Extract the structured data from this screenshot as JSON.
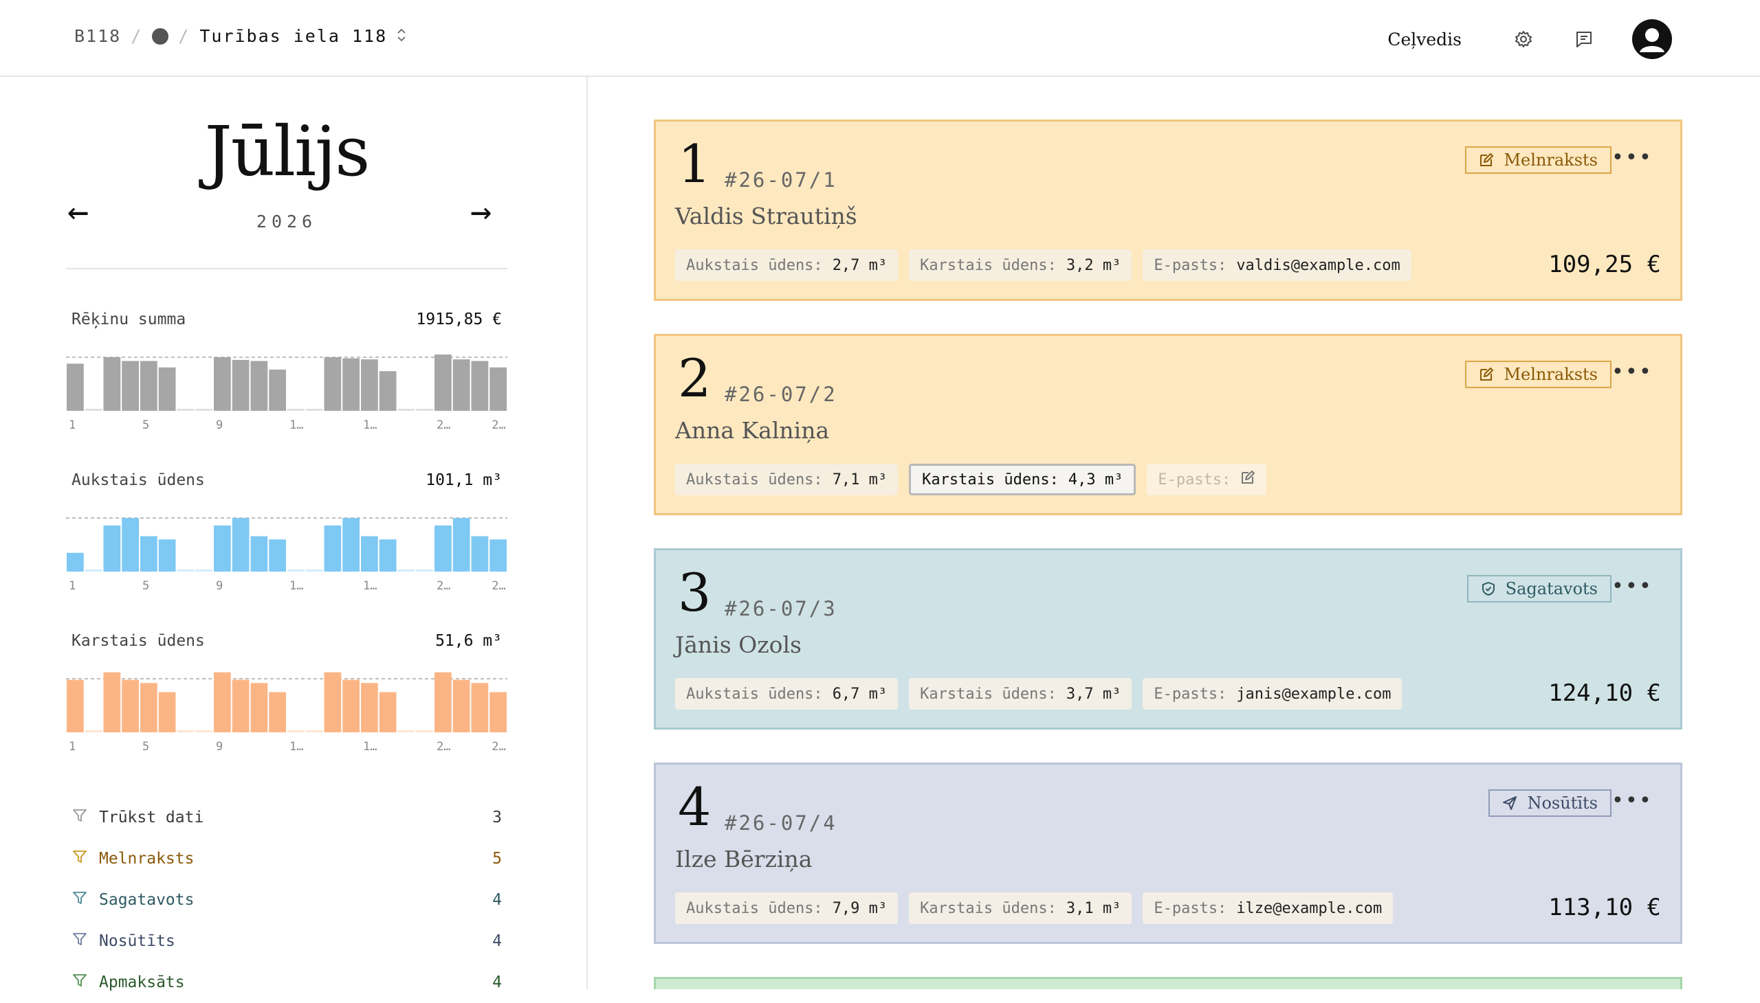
{
  "header": {
    "building_code": "B118",
    "separator": "/",
    "address": "Turības iela 118",
    "guide_label": "Ceļvedis"
  },
  "sidebar": {
    "month": "Jūlijs",
    "year": "2026",
    "prev_arrow": "←",
    "next_arrow": "→",
    "metrics": [
      {
        "label": "Rēķinu summa",
        "value": "1915,85 €",
        "color": "#a6a6a6",
        "values": [
          0.88,
          0.02,
          1.0,
          0.93,
          0.93,
          0.81,
          0.02,
          0.02,
          1.0,
          0.95,
          0.93,
          0.77,
          0.02,
          0.02,
          1.0,
          0.98,
          0.96,
          0.74,
          0.02,
          0.02,
          1.05,
          0.96,
          0.93,
          0.81
        ],
        "tick_labels": [
          "1",
          "5",
          "9",
          "1…",
          "1…",
          "2…",
          "2…"
        ]
      },
      {
        "label": "Aukstais ūdens",
        "value": "101,1 m³",
        "color": "#7ec8f4",
        "values": [
          0.35,
          0.02,
          0.86,
          1.0,
          0.66,
          0.6,
          0.02,
          0.02,
          0.86,
          1.0,
          0.66,
          0.6,
          0.02,
          0.02,
          0.86,
          1.0,
          0.66,
          0.6,
          0.02,
          0.02,
          0.86,
          1.0,
          0.66,
          0.6
        ],
        "tick_labels": [
          "1",
          "5",
          "9",
          "1…",
          "1…",
          "2…",
          "2…"
        ]
      },
      {
        "label": "Karstais ūdens",
        "value": "51,6 m³",
        "color": "#fbb585",
        "values": [
          0.98,
          0.02,
          1.12,
          0.98,
          0.92,
          0.75,
          0.02,
          0.02,
          1.12,
          0.98,
          0.92,
          0.75,
          0.02,
          0.02,
          1.12,
          0.98,
          0.92,
          0.75,
          0.02,
          0.02,
          1.12,
          0.98,
          0.92,
          0.75
        ],
        "tick_labels": [
          "1",
          "5",
          "9",
          "1…",
          "1…",
          "2…",
          "2…"
        ]
      }
    ],
    "filters": [
      {
        "label": "Trūkst dati",
        "count": "3",
        "color": "#3a3a3a",
        "icon_color": "#9a9a9a"
      },
      {
        "label": "Melnraksts",
        "count": "5",
        "color": "#8a5a0a",
        "icon_color": "#c8961e"
      },
      {
        "label": "Sagatavots",
        "count": "4",
        "color": "#2f5a63",
        "icon_color": "#4a8a96"
      },
      {
        "label": "Nosūtīts",
        "count": "4",
        "color": "#3e4b66",
        "icon_color": "#6b7ea0"
      },
      {
        "label": "Apmaksāts",
        "count": "4",
        "color": "#2c5a2c",
        "icon_color": "#4f8f4f"
      }
    ]
  },
  "invoices": [
    {
      "number": "1",
      "code": "#26-07/1",
      "name": "Valdis Strautiņš",
      "status": "Melnraksts",
      "status_icon": "edit-icon",
      "cold_label": "Aukstais ūdens:",
      "cold_value": "2,7 m³",
      "hot_label": "Karstais ūdens:",
      "hot_value": "3,2 m³",
      "email_label": "E-pasts:",
      "email_value": "valdis@example.com",
      "amount": "109,25 €",
      "bg": "#fde8bf",
      "border": "#f1c57c",
      "chip_bg": "#f6efe0",
      "status_color": "#8a5a0a",
      "status_border": "#dba746"
    },
    {
      "number": "2",
      "code": "#26-07/2",
      "name": "Anna Kalniņa",
      "status": "Melnraksts",
      "status_icon": "edit-icon",
      "cold_label": "Aukstais ūdens:",
      "cold_value": "7,1 m³",
      "hot_label": "Karstais ūdens:",
      "hot_value": "4,3 m³",
      "email_label": "E-pasts:",
      "email_value": "",
      "amount": "",
      "bg": "#fde8bf",
      "border": "#f1c57c",
      "chip_bg": "#f6efe0",
      "status_color": "#8a5a0a",
      "status_border": "#dba746"
    },
    {
      "number": "3",
      "code": "#26-07/3",
      "name": "Jānis Ozols",
      "status": "Sagatavots",
      "status_icon": "shield-check-icon",
      "cold_label": "Aukstais ūdens:",
      "cold_value": "6,7 m³",
      "hot_label": "Karstais ūdens:",
      "hot_value": "3,7 m³",
      "email_label": "E-pasts:",
      "email_value": "janis@example.com",
      "amount": "124,10 €",
      "bg": "#cfe3e6",
      "border": "#a9cbd2",
      "chip_bg": "#f3efe6",
      "status_color": "#2f5a63",
      "status_border": "#8fb5bd"
    },
    {
      "number": "4",
      "code": "#26-07/4",
      "name": "Ilze Bērziņa",
      "status": "Nosūtīts",
      "status_icon": "send-icon",
      "cold_label": "Aukstais ūdens:",
      "cold_value": "7,9 m³",
      "hot_label": "Karstais ūdens:",
      "hot_value": "3,1 m³",
      "email_label": "E-pasts:",
      "email_value": "ilze@example.com",
      "amount": "113,10 €",
      "bg": "#d9deea",
      "border": "#bcc5d8",
      "chip_bg": "#f3efe6",
      "status_color": "#3e4b66",
      "status_border": "#8e9bb8"
    }
  ],
  "next_card_color": "#cdebd0",
  "next_card_border": "#a5d6a9"
}
